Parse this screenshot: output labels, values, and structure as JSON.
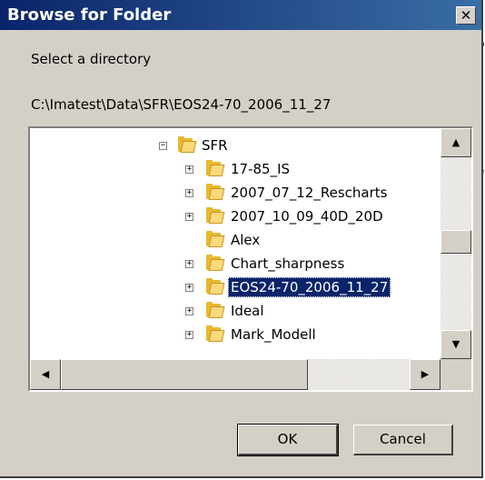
{
  "background_fragments": [
    "o",
    "e"
  ],
  "dialog": {
    "title": "Browse for Folder",
    "close_label": "✕",
    "prompt": "Select a directory",
    "current_path": "C:\\Imatest\\Data\\SFR\\EOS24-70_2006_11_27"
  },
  "tree": {
    "items": [
      {
        "label": "SFR",
        "expander": "−"
      },
      {
        "label": "17-85_IS",
        "expander": "+"
      },
      {
        "label": "2007_07_12_Rescharts",
        "expander": "+"
      },
      {
        "label": "2007_10_09_40D_20D",
        "expander": "+"
      },
      {
        "label": "Alex",
        "expander": ""
      },
      {
        "label": "Chart_sharpness",
        "expander": "+"
      },
      {
        "label": "EOS24-70_2006_11_27",
        "expander": "+",
        "selected": true
      },
      {
        "label": "Ideal",
        "expander": "+"
      },
      {
        "label": "Mark_Modell",
        "expander": "+"
      }
    ]
  },
  "scrollbar": {
    "up_arrow": "▲",
    "down_arrow": "▼",
    "left_arrow": "◀",
    "right_arrow": "▶"
  },
  "buttons": {
    "ok": "OK",
    "cancel": "Cancel"
  }
}
